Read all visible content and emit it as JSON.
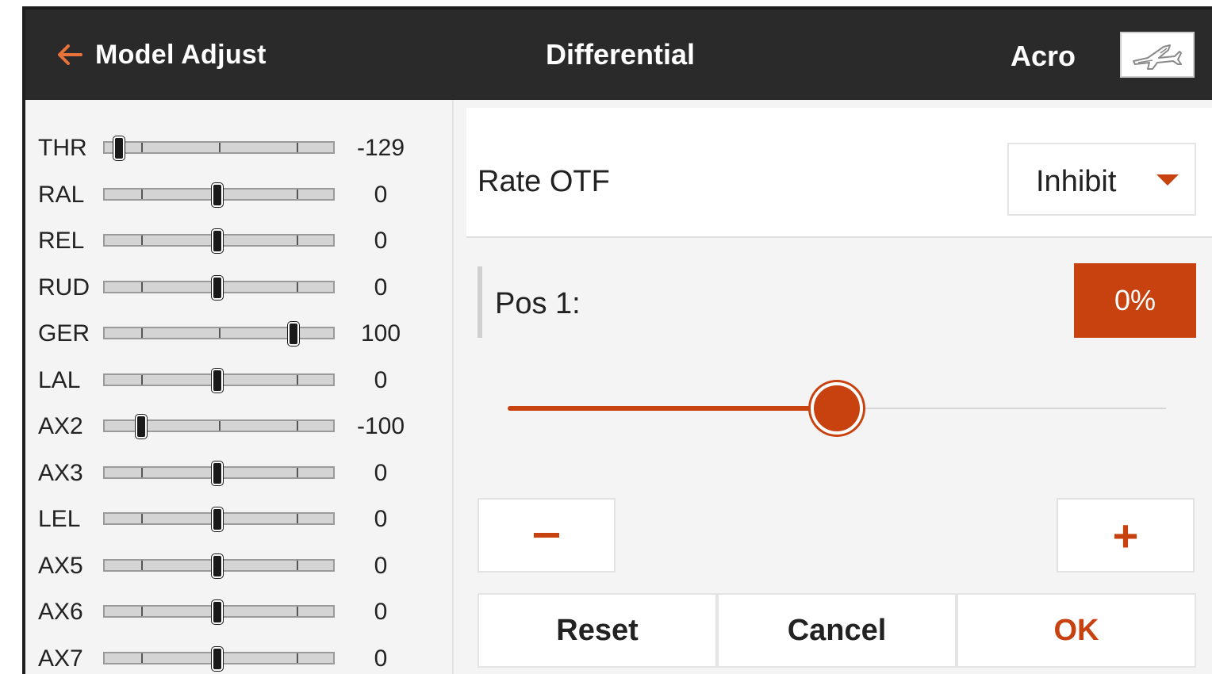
{
  "header": {
    "back_label": "Model Adjust",
    "title": "Differential",
    "model_type": "Acro",
    "back_icon": "arrow-left-icon",
    "model_icon": "airplane-icon"
  },
  "channels": [
    {
      "name": "THR",
      "value": "-129",
      "position": -129
    },
    {
      "name": "RAL",
      "value": "0",
      "position": 0
    },
    {
      "name": "REL",
      "value": "0",
      "position": 0
    },
    {
      "name": "RUD",
      "value": "0",
      "position": 0
    },
    {
      "name": "GER",
      "value": "100",
      "position": 100
    },
    {
      "name": "LAL",
      "value": "0",
      "position": 0
    },
    {
      "name": "AX2",
      "value": "-100",
      "position": -100
    },
    {
      "name": "AX3",
      "value": "0",
      "position": 0
    },
    {
      "name": "LEL",
      "value": "0",
      "position": 0
    },
    {
      "name": "AX5",
      "value": "0",
      "position": 0
    },
    {
      "name": "AX6",
      "value": "0",
      "position": 0
    },
    {
      "name": "AX7",
      "value": "0",
      "position": 0
    }
  ],
  "rate_otf": {
    "label": "Rate OTF",
    "selected": "Inhibit"
  },
  "position": {
    "label": "Pos 1:",
    "value": "0%",
    "slider_fraction": 0.5
  },
  "steppers": {
    "plus": "+"
  },
  "actions": {
    "reset": "Reset",
    "cancel": "Cancel",
    "ok": "OK"
  },
  "colors": {
    "accent": "#c84210",
    "header_bg": "#2a2a2a",
    "back_arrow": "#e8733a"
  }
}
